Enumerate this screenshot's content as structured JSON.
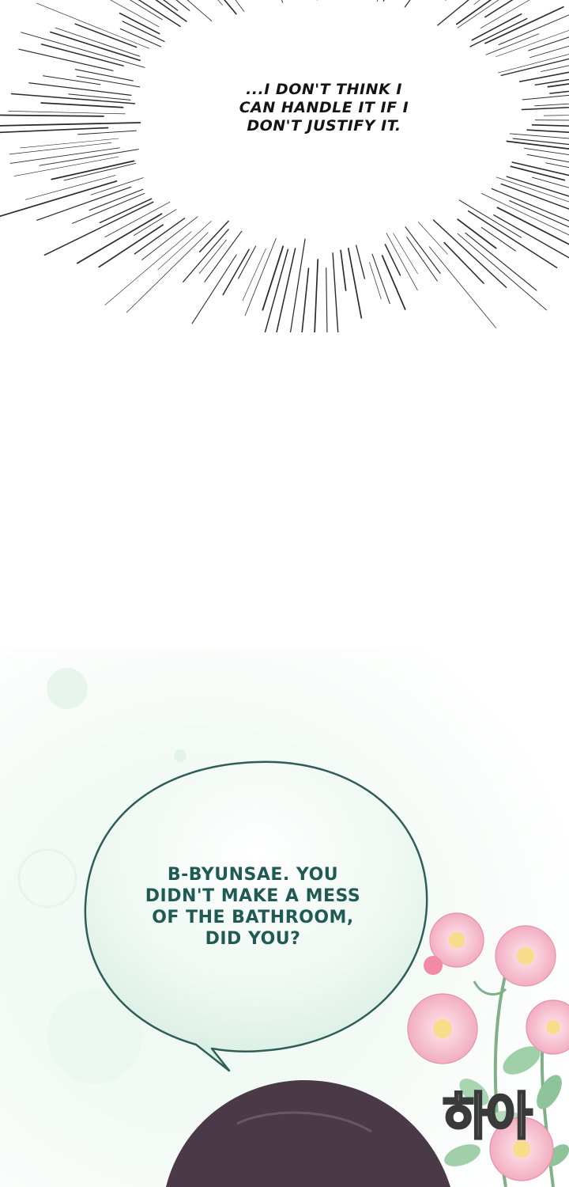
{
  "panels": {
    "thought": {
      "text": "...I DON'T THINK I\nCAN HANDLE IT IF I\nDON'T JUSTIFY IT."
    },
    "speech": {
      "text": "B-BYUNSAE. YOU\nDIDN'T MAKE A MESS\nOF THE BATHROOM,\nDID YOU?"
    },
    "sfx": {
      "text": "하아"
    }
  },
  "colors": {
    "speech_text": "#1f5a55",
    "speech_border": "#2f5e5a",
    "flower_pink": "#f4b6c6",
    "leaf_green": "#8fc49a",
    "hair_dark": "#4a3a48"
  },
  "icons": [
    "burst-lines",
    "flower-cluster",
    "character-hair"
  ]
}
